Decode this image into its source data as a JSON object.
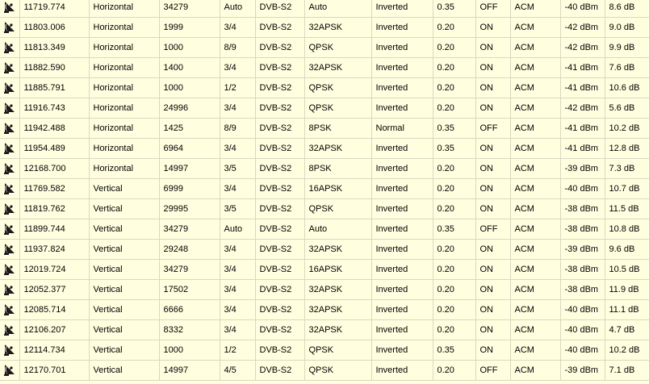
{
  "rows": [
    {
      "freq": "11719.774",
      "pol": "Horizontal",
      "sr": "34279",
      "fec": "Auto",
      "sys": "DVB-S2",
      "mod": "Auto",
      "spec": "Inverted",
      "rolloff": "0.35",
      "pilot": "OFF",
      "mode": "ACM",
      "level": "-40 dBm",
      "cn": "8.6 dB"
    },
    {
      "freq": "11803.006",
      "pol": "Horizontal",
      "sr": "1999",
      "fec": "3/4",
      "sys": "DVB-S2",
      "mod": "32APSK",
      "spec": "Inverted",
      "rolloff": "0.20",
      "pilot": "ON",
      "mode": "ACM",
      "level": "-42 dBm",
      "cn": "9.0 dB"
    },
    {
      "freq": "11813.349",
      "pol": "Horizontal",
      "sr": "1000",
      "fec": "8/9",
      "sys": "DVB-S2",
      "mod": "QPSK",
      "spec": "Inverted",
      "rolloff": "0.20",
      "pilot": "ON",
      "mode": "ACM",
      "level": "-42 dBm",
      "cn": "9.9 dB"
    },
    {
      "freq": "11882.590",
      "pol": "Horizontal",
      "sr": "1400",
      "fec": "3/4",
      "sys": "DVB-S2",
      "mod": "32APSK",
      "spec": "Inverted",
      "rolloff": "0.20",
      "pilot": "ON",
      "mode": "ACM",
      "level": "-41 dBm",
      "cn": "7.6 dB"
    },
    {
      "freq": "11885.791",
      "pol": "Horizontal",
      "sr": "1000",
      "fec": "1/2",
      "sys": "DVB-S2",
      "mod": "QPSK",
      "spec": "Inverted",
      "rolloff": "0.20",
      "pilot": "ON",
      "mode": "ACM",
      "level": "-41 dBm",
      "cn": "10.6 dB"
    },
    {
      "freq": "11916.743",
      "pol": "Horizontal",
      "sr": "24996",
      "fec": "3/4",
      "sys": "DVB-S2",
      "mod": "QPSK",
      "spec": "Inverted",
      "rolloff": "0.20",
      "pilot": "ON",
      "mode": "ACM",
      "level": "-42 dBm",
      "cn": "5.6 dB"
    },
    {
      "freq": "11942.488",
      "pol": "Horizontal",
      "sr": "1425",
      "fec": "8/9",
      "sys": "DVB-S2",
      "mod": "8PSK",
      "spec": "Normal",
      "rolloff": "0.35",
      "pilot": "OFF",
      "mode": "ACM",
      "level": "-41 dBm",
      "cn": "10.2 dB"
    },
    {
      "freq": "11954.489",
      "pol": "Horizontal",
      "sr": "6964",
      "fec": "3/4",
      "sys": "DVB-S2",
      "mod": "32APSK",
      "spec": "Inverted",
      "rolloff": "0.35",
      "pilot": "ON",
      "mode": "ACM",
      "level": "-41 dBm",
      "cn": "12.8 dB"
    },
    {
      "freq": "12168.700",
      "pol": "Horizontal",
      "sr": "14997",
      "fec": "3/5",
      "sys": "DVB-S2",
      "mod": "8PSK",
      "spec": "Inverted",
      "rolloff": "0.20",
      "pilot": "ON",
      "mode": "ACM",
      "level": "-39 dBm",
      "cn": "7.3 dB"
    },
    {
      "freq": "11769.582",
      "pol": "Vertical",
      "sr": "6999",
      "fec": "3/4",
      "sys": "DVB-S2",
      "mod": "16APSK",
      "spec": "Inverted",
      "rolloff": "0.20",
      "pilot": "ON",
      "mode": "ACM",
      "level": "-40 dBm",
      "cn": "10.7 dB"
    },
    {
      "freq": "11819.762",
      "pol": "Vertical",
      "sr": "29995",
      "fec": "3/5",
      "sys": "DVB-S2",
      "mod": "QPSK",
      "spec": "Inverted",
      "rolloff": "0.20",
      "pilot": "ON",
      "mode": "ACM",
      "level": "-38 dBm",
      "cn": "11.5 dB"
    },
    {
      "freq": "11899.744",
      "pol": "Vertical",
      "sr": "34279",
      "fec": "Auto",
      "sys": "DVB-S2",
      "mod": "Auto",
      "spec": "Inverted",
      "rolloff": "0.35",
      "pilot": "OFF",
      "mode": "ACM",
      "level": "-38 dBm",
      "cn": "10.8 dB"
    },
    {
      "freq": "11937.824",
      "pol": "Vertical",
      "sr": "29248",
      "fec": "3/4",
      "sys": "DVB-S2",
      "mod": "32APSK",
      "spec": "Inverted",
      "rolloff": "0.20",
      "pilot": "ON",
      "mode": "ACM",
      "level": "-39 dBm",
      "cn": "9.6 dB"
    },
    {
      "freq": "12019.724",
      "pol": "Vertical",
      "sr": "34279",
      "fec": "3/4",
      "sys": "DVB-S2",
      "mod": "16APSK",
      "spec": "Inverted",
      "rolloff": "0.20",
      "pilot": "ON",
      "mode": "ACM",
      "level": "-38 dBm",
      "cn": "10.5 dB"
    },
    {
      "freq": "12052.377",
      "pol": "Vertical",
      "sr": "17502",
      "fec": "3/4",
      "sys": "DVB-S2",
      "mod": "32APSK",
      "spec": "Inverted",
      "rolloff": "0.20",
      "pilot": "ON",
      "mode": "ACM",
      "level": "-38 dBm",
      "cn": "11.9 dB"
    },
    {
      "freq": "12085.714",
      "pol": "Vertical",
      "sr": "6666",
      "fec": "3/4",
      "sys": "DVB-S2",
      "mod": "32APSK",
      "spec": "Inverted",
      "rolloff": "0.20",
      "pilot": "ON",
      "mode": "ACM",
      "level": "-40 dBm",
      "cn": "11.1 dB"
    },
    {
      "freq": "12106.207",
      "pol": "Vertical",
      "sr": "8332",
      "fec": "3/4",
      "sys": "DVB-S2",
      "mod": "32APSK",
      "spec": "Inverted",
      "rolloff": "0.20",
      "pilot": "ON",
      "mode": "ACM",
      "level": "-40 dBm",
      "cn": "4.7 dB"
    },
    {
      "freq": "12114.734",
      "pol": "Vertical",
      "sr": "1000",
      "fec": "1/2",
      "sys": "DVB-S2",
      "mod": "QPSK",
      "spec": "Inverted",
      "rolloff": "0.35",
      "pilot": "ON",
      "mode": "ACM",
      "level": "-40 dBm",
      "cn": "10.2 dB"
    },
    {
      "freq": "12170.701",
      "pol": "Vertical",
      "sr": "14997",
      "fec": "4/5",
      "sys": "DVB-S2",
      "mod": "QPSK",
      "spec": "Inverted",
      "rolloff": "0.20",
      "pilot": "OFF",
      "mode": "ACM",
      "level": "-39 dBm",
      "cn": "7.1 dB"
    }
  ],
  "row_icon": "satellite-dish-icon",
  "colors": {
    "background": "#ffffe0",
    "gridline": "#d8d8c0",
    "text": "#000000"
  }
}
